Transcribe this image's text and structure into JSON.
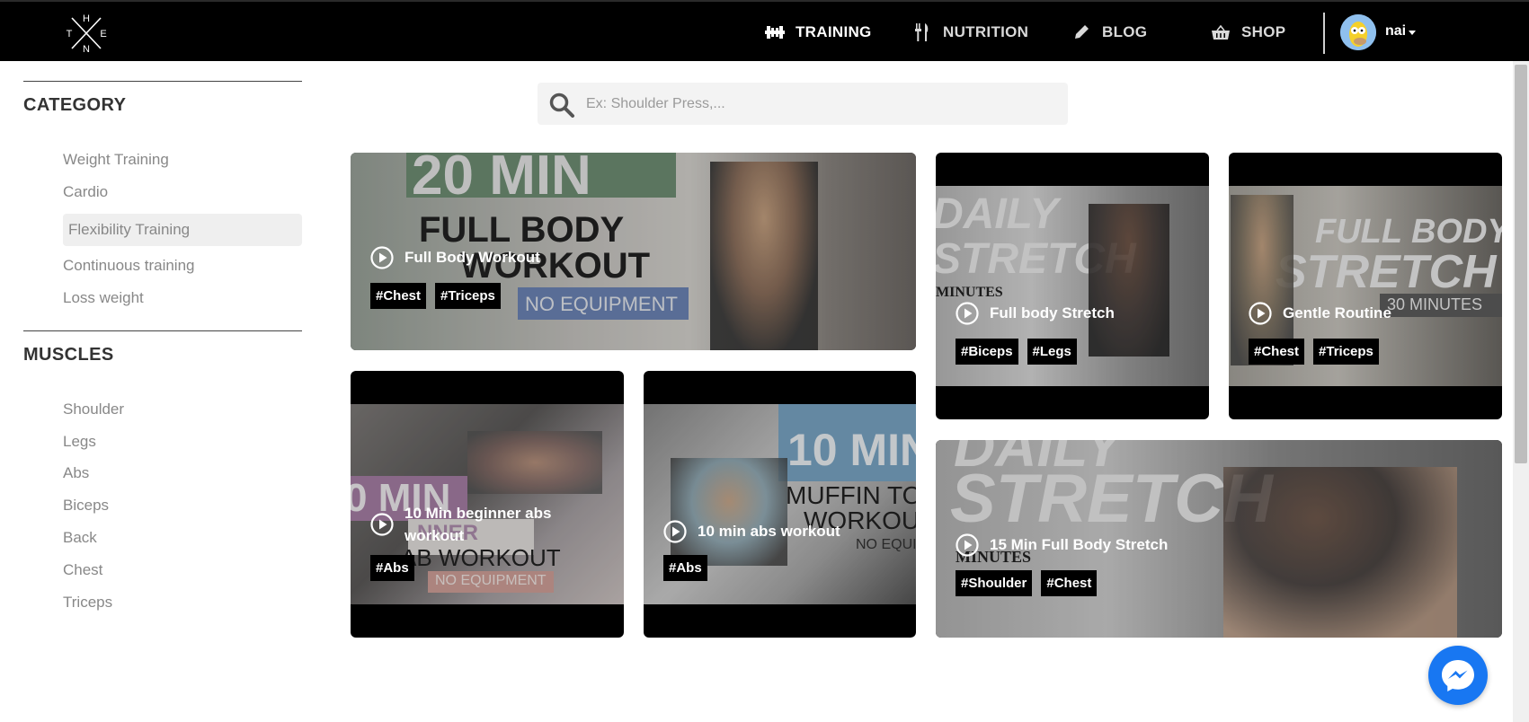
{
  "header": {
    "logo_letters": [
      "H",
      "T",
      "E",
      "N"
    ],
    "nav": [
      {
        "label": "TRAINING",
        "icon": "dumbbell-icon",
        "active": true
      },
      {
        "label": "NUTRITION",
        "icon": "fork-knife-icon",
        "active": false
      },
      {
        "label": "BLOG",
        "icon": "pencil-icon",
        "active": false
      },
      {
        "label": "SHOP",
        "icon": "basket-icon",
        "active": false
      }
    ],
    "user": {
      "name": "nai"
    }
  },
  "sidebar": {
    "category_title": "CATEGORY",
    "categories": [
      {
        "label": "Weight Training"
      },
      {
        "label": "Cardio"
      },
      {
        "label": "Flexibility Training",
        "selected": true
      },
      {
        "label": "Continuous training"
      },
      {
        "label": "Loss weight"
      }
    ],
    "muscles_title": "MUSCLES",
    "muscles": [
      {
        "label": "Shoulder"
      },
      {
        "label": "Legs"
      },
      {
        "label": "Abs"
      },
      {
        "label": "Biceps"
      },
      {
        "label": "Back"
      },
      {
        "label": "Chest"
      },
      {
        "label": "Triceps"
      }
    ]
  },
  "search": {
    "placeholder": "Ex: Shoulder Press,..."
  },
  "workouts": [
    {
      "title": "Full Body Workout",
      "tags": [
        "#Chest",
        "#Triceps"
      ],
      "thumb_text": [
        "20 MIN",
        "FULL BODY",
        "WORKOUT",
        "NO EQUIPMENT"
      ]
    },
    {
      "title": "Full body Stretch",
      "tags": [
        "#Biceps",
        "#Legs"
      ],
      "thumb_text": [
        "DAILY",
        "STRETCH",
        "MINUTES"
      ]
    },
    {
      "title": "Gentle Routine",
      "tags": [
        "#Chest",
        "#Triceps"
      ],
      "thumb_text": [
        "FULL BODY",
        "STRETCH",
        "30 MINUTES"
      ]
    },
    {
      "title": "10 Min beginner abs workout",
      "tags": [
        "#Abs"
      ],
      "thumb_text": [
        "0 MIN",
        "NNER",
        "AB WORKOUT",
        "NO EQUIPMENT"
      ]
    },
    {
      "title": "10 min abs workout",
      "tags": [
        "#Abs"
      ],
      "thumb_text": [
        "10 MIN",
        "MUFFIN TO",
        "WORKOUT",
        "NO EQUIP"
      ]
    },
    {
      "title": "15 Min Full Body Stretch",
      "tags": [
        "#Shoulder",
        "#Chest"
      ],
      "thumb_text": [
        "DAILY",
        "STRETCH",
        "MINUTES"
      ]
    }
  ],
  "colors": {
    "header_bg": "#000000",
    "messenger": "#1877f2",
    "selected_bg": "#efefef"
  }
}
